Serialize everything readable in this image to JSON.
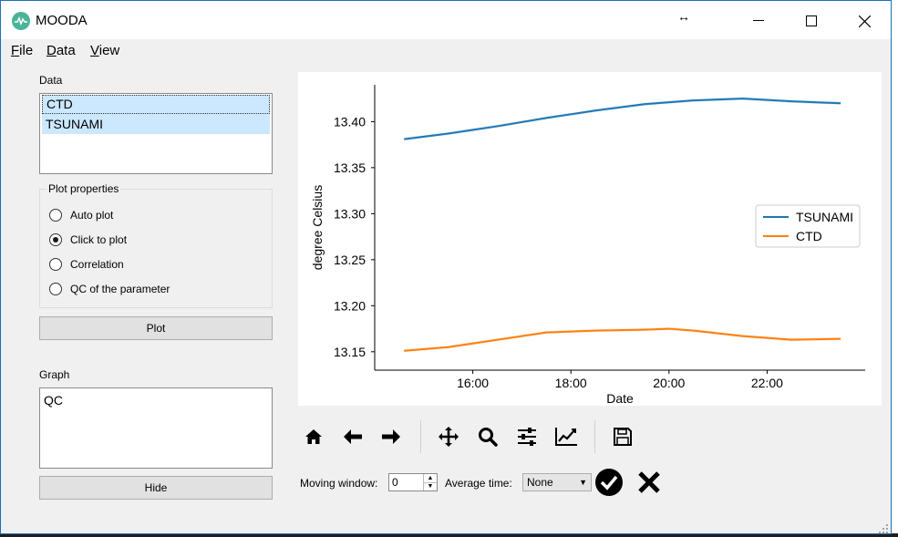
{
  "window": {
    "title": "MOODA",
    "icon": "mooda-app-icon"
  },
  "menu": [
    {
      "label": "File",
      "mnemonic": "F",
      "rest": "ile"
    },
    {
      "label": "Data",
      "mnemonic": "D",
      "rest": "ata"
    },
    {
      "label": "View",
      "mnemonic": "V",
      "rest": "iew"
    }
  ],
  "data_panel": {
    "label": "Data",
    "items": [
      {
        "label": "CTD",
        "focused": true
      },
      {
        "label": "TSUNAMI",
        "selected": true
      }
    ]
  },
  "plot_properties": {
    "title": "Plot properties",
    "options": [
      {
        "label": "Auto plot",
        "checked": false
      },
      {
        "label": "Click to plot",
        "checked": true
      },
      {
        "label": "Correlation",
        "checked": false
      },
      {
        "label": "QC of the parameter",
        "checked": false
      }
    ],
    "plot_button": "Plot"
  },
  "graph_panel": {
    "label": "Graph",
    "items": [
      "QC"
    ],
    "hide_button": "Hide"
  },
  "controls": {
    "moving_window_label": "Moving window:",
    "moving_window_value": "0",
    "average_time_label": "Average time:",
    "average_time_value": "None"
  },
  "toolbar_icons": [
    "home-icon",
    "back-arrow-icon",
    "forward-arrow-icon",
    "pan-icon",
    "zoom-icon",
    "configure-subplots-icon",
    "edit-axis-icon",
    "save-icon"
  ],
  "chart_data": {
    "type": "line",
    "xlabel": "Date",
    "ylabel": "degree Celsius",
    "ylim": [
      13.13,
      13.44
    ],
    "xlim_hours": [
      14.0,
      24.0
    ],
    "yticks": [
      "13.15",
      "13.20",
      "13.25",
      "13.30",
      "13.35",
      "13.40"
    ],
    "xticks": [
      "16:00",
      "18:00",
      "20:00",
      "22:00"
    ],
    "legend_position": "center-right",
    "series": [
      {
        "name": "TSUNAMI",
        "color": "#1f77b4",
        "x": [
          14.6,
          15.5,
          16.5,
          17.5,
          18.5,
          19.5,
          20.5,
          21.5,
          22.5,
          23.5
        ],
        "values": [
          13.381,
          13.387,
          13.395,
          13.404,
          13.412,
          13.419,
          13.423,
          13.425,
          13.422,
          13.42
        ]
      },
      {
        "name": "CTD",
        "color": "#ff7f0e",
        "x": [
          14.6,
          15.5,
          16.5,
          17.5,
          18.5,
          19.5,
          20.0,
          20.5,
          21.5,
          22.5,
          23.5
        ],
        "values": [
          13.151,
          13.155,
          13.163,
          13.171,
          13.173,
          13.174,
          13.175,
          13.173,
          13.167,
          13.163,
          13.164
        ]
      }
    ]
  }
}
